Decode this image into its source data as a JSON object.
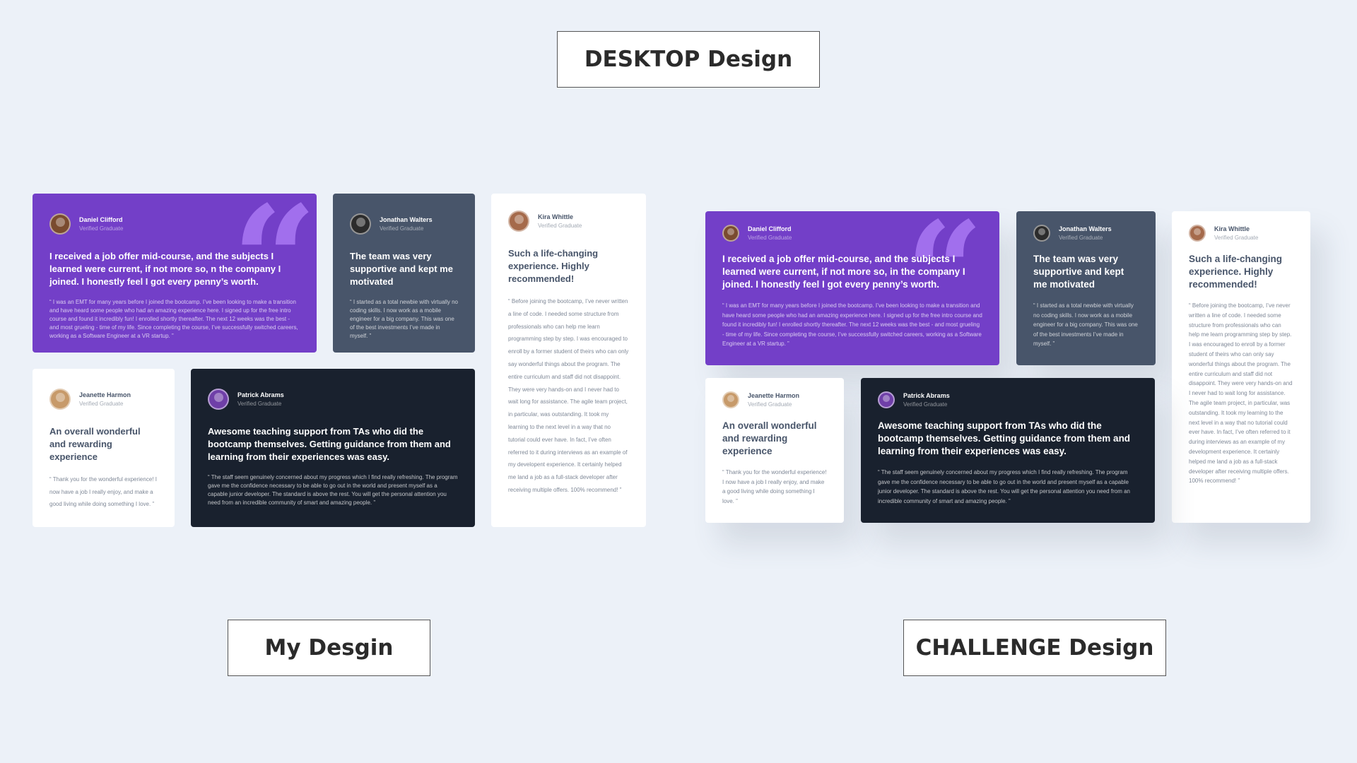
{
  "labels": {
    "desktop": "DESKTOP Design",
    "mine": "My Desgin",
    "challenge": "CHALLENGE Design"
  },
  "colors": {
    "background": "#ecf1f8",
    "purple": "#733fc8",
    "gray": "#48556a",
    "dark": "#19212e",
    "white": "#ffffff",
    "quote_mark": "#a775f1"
  },
  "my_design": {
    "daniel": {
      "name": "Daniel Clifford",
      "status": "Verified Graduate",
      "headline": "I received a job offer mid-course, and the subjects I learned were current, if not more so, n the company I joined. I honestly feel I got every penny’s worth.",
      "body": "“ I was an EMT for many years before I joined the bootcamp. I’ve been looking to make a transition and have heard some people who had an amazing experience here. I signed up for the free intro course and found it incredibly fun! I enrolled shortly thereafter. The next 12 weeks was the best - and most grueling - time of my life. Since completing the course, I’ve successfully switched careers, working as a Software Engineer at a VR startup. ”"
    },
    "jonathan": {
      "name": "Jonathan Walters",
      "status": "Verified Graduate",
      "headline": "The team was very supportive and kept me motivated",
      "body": "“ I started as a total newbie with virtually no coding skills. I now work as a mobile engineer for a big company. This was one of the best investments I’ve made in myself. ”"
    },
    "kira": {
      "name": "Kira Whittle",
      "status": "Verified Graduate",
      "headline": "Such a life-changing experience. Highly recommended!",
      "body": "“ Before joining the bootcamp, I’ve never written a line of code. I needed some structure from professionals who can help me learn programming step by step. I was encouraged to enroll by a former student of theirs who can only say wonderful things about the program. The entire curriculum and staff did not disappoint. They were very hands-on and I never had to wait long for assistance. The agile team project, in particular, was outstanding. It took my learning to the next level in a way that no tutorial could ever have. In fact, I’ve often referred to it during interviews as an example of my developent experience. It certainly helped me land a job as a full-stack developer after receiving multiple offers. 100% recommend! ”"
    },
    "jeanette": {
      "name": "Jeanette Harmon",
      "status": "Verified Graduate",
      "headline": "An overall wonderful and rewarding experience",
      "body": "“ Thank you for the wonderful experience! I now have a job I really enjoy, and make a good living while doing something I love. ”"
    },
    "patrick": {
      "name": "Patrick Abrams",
      "status": "Verified Graduate",
      "headline": "Awesome teaching support from TAs who did the bootcamp themselves. Getting guidance from them and learning from their experiences was easy.",
      "body": "“ The staff seem genuinely concerned about my progress which I find really refreshing. The program gave me the confidence necessary to be able to go out in the world and present myself as a capable junior developer. The standard is above the rest. You will get the personal attention you need from an incredible community of smart and amazing people. ”"
    }
  },
  "challenge_design": {
    "daniel": {
      "name": "Daniel Clifford",
      "status": "Verified Graduate",
      "headline": "I received a job offer mid-course, and the subjects I learned were current, if not more so, in the company I joined. I honestly feel I got every penny’s worth.",
      "body": "“ I was an EMT for many years before I joined the bootcamp. I’ve been looking to make a transition and have heard some people who had an amazing experience here. I signed up for the free intro course and found it incredibly fun! I enrolled shortly thereafter. The next 12 weeks was the best - and most grueling - time of my life. Since completing the course, I’ve successfully switched careers, working as a Software Engineer at a VR startup. ”"
    },
    "jonathan": {
      "name": "Jonathan Walters",
      "status": "Verified Graduate",
      "headline": "The team was very supportive and kept me motivated",
      "body": "“ I started as a total newbie with virtually no coding skills. I now work as a mobile engineer for a big company. This was one of the best investments I’ve made in myself. ”"
    },
    "kira": {
      "name": "Kira Whittle",
      "status": "Verified Graduate",
      "headline": "Such a life-changing experience. Highly recommended!",
      "body": "“ Before joining the bootcamp, I’ve never written a line of code. I needed some structure from professionals who can help me learn programming step by step. I was encouraged to enroll by a former student of theirs who can only say wonderful things about the program. The entire curriculum and staff did not disappoint. They were very hands-on and I never had to wait long for assistance. The agile team project, in particular, was outstanding. It took my learning to the next level in a way that no tutorial could ever have. In fact, I’ve often referred to it during interviews as an example of my development experience. It certainly helped me land a job as a full-stack developer after receiving multiple offers. 100% recommend! ”"
    },
    "jeanette": {
      "name": "Jeanette Harmon",
      "status": "Verified Graduate",
      "headline": "An overall wonderful and rewarding experience",
      "body": "“ Thank you for the wonderful experience! I now have a job I really enjoy, and make a good living while doing something I love. ”"
    },
    "patrick": {
      "name": "Patrick Abrams",
      "status": "Verified Graduate",
      "headline": "Awesome teaching support from TAs who did the bootcamp themselves. Getting guidance from them and learning from their experiences was easy.",
      "body": "“ The staff seem genuinely concerned about my progress which I find really refreshing. The program gave me the confidence necessary to be able to go out in the world and present myself as a capable junior developer. The standard is above the rest. You will get the personal attention you need from an incredible community of smart and amazing people. ”"
    }
  }
}
